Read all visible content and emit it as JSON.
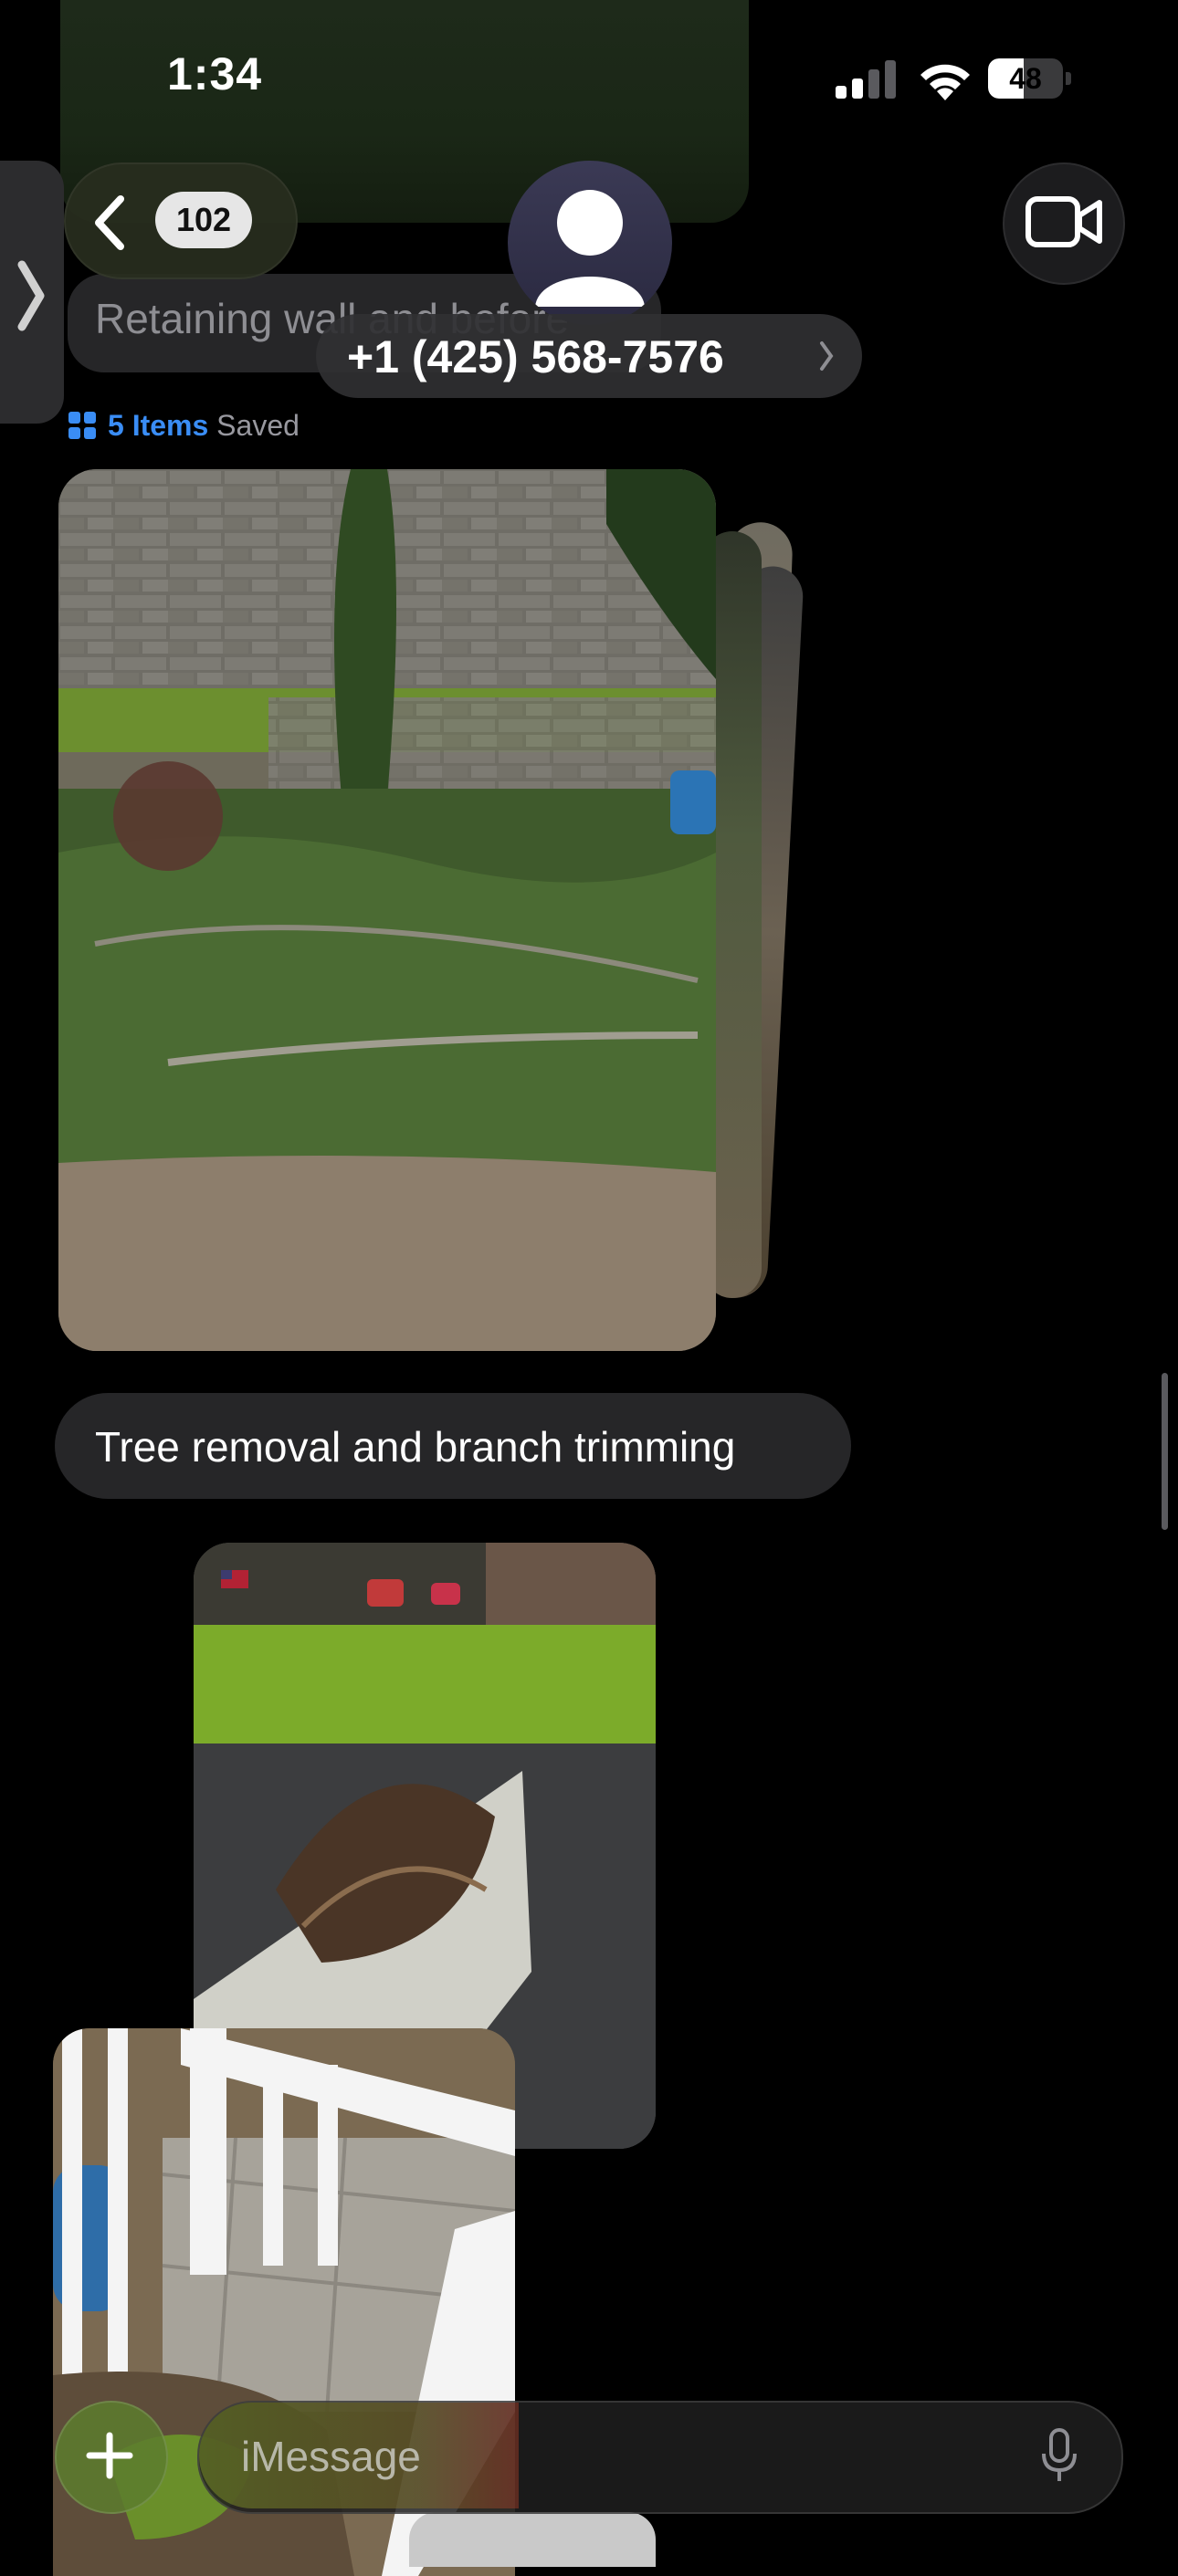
{
  "status_bar": {
    "time": "1:34",
    "battery": "48",
    "battery_level": 0.48
  },
  "header": {
    "unread_count": "102",
    "contact": "+1 (425) 568-7576"
  },
  "messages": {
    "faded_text": "Retaining wall and before",
    "saved_count": "5 Items",
    "saved_label": "Saved",
    "text_bubble": "Tree removal and branch trimming"
  },
  "compose": {
    "placeholder": "iMessage"
  },
  "icons": {
    "back": "chevron-left-icon",
    "side": "chevron-right-icon",
    "video": "video-camera-icon",
    "plus": "plus-icon",
    "mic": "microphone-icon",
    "avatar": "person-icon",
    "saved": "grid-icon"
  },
  "colors": {
    "link_blue": "#3a8df5",
    "bubble_gray": "#262628"
  }
}
